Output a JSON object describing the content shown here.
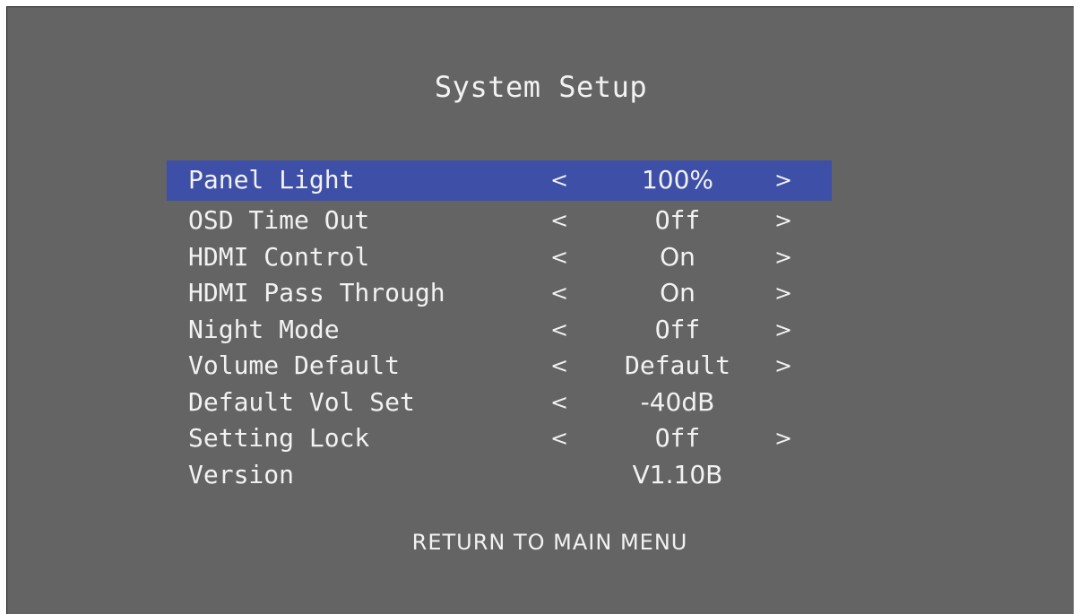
{
  "title": "System Setup",
  "settings": [
    {
      "label": "Panel Light",
      "left": "<",
      "value": "100%",
      "right": ">",
      "selected": true
    },
    {
      "label": "OSD Time Out",
      "left": "<",
      "value": "Off",
      "right": ">"
    },
    {
      "label": "HDMI Control",
      "left": "<",
      "value": "On",
      "right": ">"
    },
    {
      "label": "HDMI Pass Through",
      "left": "<",
      "value": "On",
      "right": ">"
    },
    {
      "label": "Night Mode",
      "left": "<",
      "value": "Off",
      "right": ">"
    },
    {
      "label": "Volume Default",
      "left": "<",
      "value": "Default",
      "right": ">"
    },
    {
      "label": "Default Vol Set",
      "left": "<",
      "value": "-40dB",
      "right": ""
    },
    {
      "label": "Setting Lock",
      "left": "<",
      "value": "Off",
      "right": ">"
    },
    {
      "label": "Version",
      "left": "",
      "value": "V1.10B",
      "right": ""
    }
  ],
  "return_label": "RETURN TO MAIN MENU",
  "colors": {
    "background": "#646464",
    "highlight": "#3e4fa8",
    "text": "#f2f2f2"
  }
}
